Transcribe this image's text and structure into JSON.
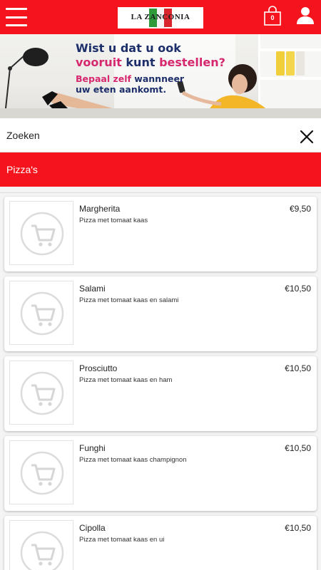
{
  "header": {
    "logo_text": "LA ZANCONIA",
    "cart_count": "0",
    "colors": {
      "brand_red": "#f5141e"
    }
  },
  "banner": {
    "line1": "Wist u dat u ook",
    "line2_a": "vooruit",
    "line2_b": "kunt",
    "line2_c": "bestellen?",
    "line3_a": "Bepaal zelf",
    "line3_b": "wannneer",
    "line4": "uw eten aankomt."
  },
  "search": {
    "placeholder": "Zoeken",
    "value": ""
  },
  "category": {
    "title": "Pizza's"
  },
  "products": [
    {
      "name": "Margherita",
      "description": "Pizza met tomaat kaas",
      "price": "€9,50"
    },
    {
      "name": "Salami",
      "description": "Pizza met tomaat kaas en salami",
      "price": "€10,50"
    },
    {
      "name": "Prosciutto",
      "description": "Pizza met tomaat kaas en ham",
      "price": "€10,50"
    },
    {
      "name": "Funghi",
      "description": "Pizza met tomaat kaas champignon",
      "price": "€10,50"
    },
    {
      "name": "Cipolla",
      "description": "Pizza met tomaat kaas en ui",
      "price": "€10,50"
    }
  ],
  "icons": {
    "menu": "hamburger-menu-icon",
    "cart": "shopping-bag-icon",
    "account": "user-icon",
    "clear": "close-icon",
    "placeholder": "shopping-cart-icon"
  }
}
